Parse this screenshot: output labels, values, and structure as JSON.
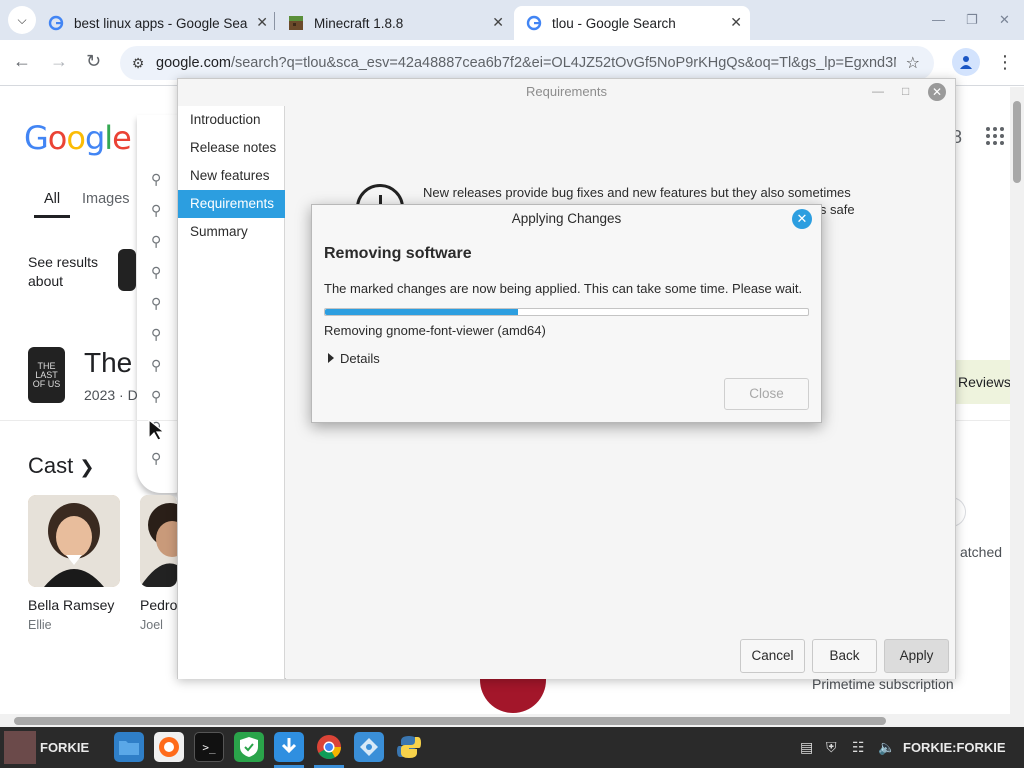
{
  "browser": {
    "tabs": [
      {
        "title": "best linux apps - Google Sea",
        "favicon": "google-icon"
      },
      {
        "title": "Minecraft 1.8.8",
        "favicon": "minecraft-icon"
      },
      {
        "title": "tlou - Google Search",
        "favicon": "google-icon",
        "active": true
      }
    ],
    "url_domain": "google.com",
    "url_rest": "/search?q=tlou&sca_esv=42a48887cea6b7f2&ei=OL4JZ52tOvGf5NoP9rKHgQs&oq=Tl&gs_lp=Egxnd3M..."
  },
  "google": {
    "logo": "Google",
    "tab_all": "All",
    "tab_images": "Images",
    "see_results": "See results about",
    "title_partial": "The",
    "year_partial": "2023 · D",
    "cast_label": "Cast",
    "cast": [
      {
        "name": "Bella Ramsey",
        "role": "Ellie"
      },
      {
        "name": "Pedro",
        "role": "Joel"
      }
    ],
    "reviews": "Reviews",
    "watched": "atched",
    "prime": "Primetime subscription",
    "thumb_text": "THE LAST OF US"
  },
  "requirements": {
    "title": "Requirements",
    "sidebar": [
      {
        "label": "Introduction"
      },
      {
        "label": "Release notes"
      },
      {
        "label": "New features"
      },
      {
        "label": "Requirements",
        "selected": true
      },
      {
        "label": "Summary"
      }
    ],
    "text_line1": "New releases provide bug fixes and new features but they also sometimes",
    "text_line2": "is safe",
    "buttons": {
      "cancel": "Cancel",
      "back": "Back",
      "apply": "Apply"
    }
  },
  "dialog": {
    "title": "Applying Changes",
    "heading": "Removing software",
    "description": "The marked changes are now being applied. This can take some time. Please wait.",
    "progress_percent": 40,
    "status": "Removing gnome-font-viewer (amd64)",
    "details": "Details",
    "close": "Close"
  },
  "taskbar": {
    "user_label": "FORKIE",
    "session_label": "FORKIE:FORKIE",
    "apps": [
      "files-icon",
      "firefox-icon",
      "terminal-icon",
      "shield-icon",
      "download-icon",
      "chrome-icon",
      "vpn-icon",
      "python-icon"
    ],
    "tray": [
      "clipboard-icon",
      "shield-tray-icon",
      "network-icon",
      "volume-icon"
    ]
  },
  "colors": {
    "accent": "#2c9ee0",
    "tabbar": "#dfe6f1",
    "taskbar": "#2a2a2a"
  }
}
